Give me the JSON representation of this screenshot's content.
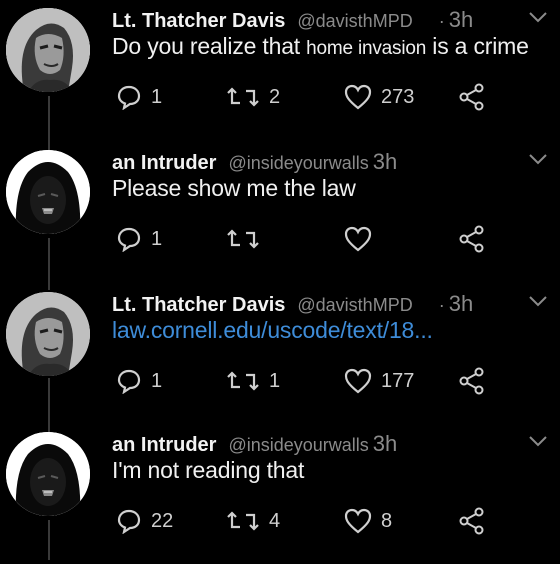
{
  "tweets": [
    {
      "name": "Lt. Thatcher Davis",
      "handle": "@davisthMPD",
      "dot": "·",
      "time": "3h",
      "text_a": "Do you realize that ",
      "text_b": "home invasion",
      "text_c": " is a crime",
      "reply_count": "1",
      "retweet_count": "2",
      "like_count": "273"
    },
    {
      "name": "an Intruder",
      "handle": "@insideyourwalls",
      "time": "3h",
      "text": "Please show me the law",
      "reply_count": "1",
      "retweet_count": "",
      "like_count": ""
    },
    {
      "name": "Lt. Thatcher Davis",
      "handle": "@davisthMPD",
      "dot": "·",
      "time": "3h",
      "link": "law.cornell.edu/uscode/text/18...",
      "reply_count": "1",
      "retweet_count": "1",
      "like_count": "177"
    },
    {
      "name": "an Intruder",
      "handle": "@insideyourwalls",
      "time": "3h",
      "text": "I'm not reading that",
      "reply_count": "22",
      "retweet_count": "4",
      "like_count": "8"
    }
  ],
  "colors": {
    "background": "#000000",
    "text": "#f0f0f0",
    "muted": "#8b8b8b",
    "link": "#3e8cd8"
  },
  "icons": [
    "reply-icon",
    "retweet-icon",
    "like-icon",
    "share-icon",
    "chevron-down-icon"
  ]
}
